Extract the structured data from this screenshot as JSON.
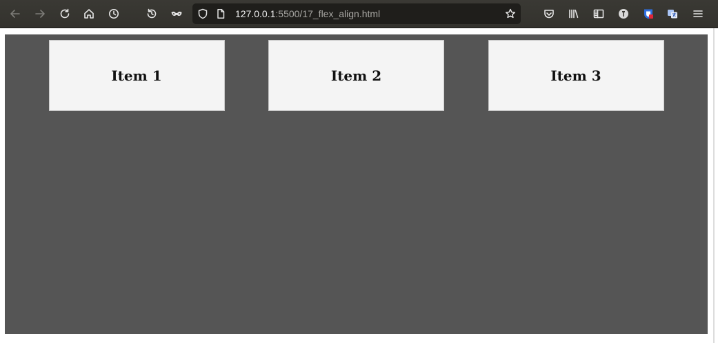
{
  "browser": {
    "url_host": "127.0.0.1",
    "url_path": ":5500/17_flex_align.html",
    "icons": {
      "back": "back-arrow-icon",
      "forward": "forward-arrow-icon",
      "reload": "reload-icon",
      "home": "home-icon",
      "history": "clock-icon",
      "restore": "history-restore-icon",
      "private": "mask-icon",
      "shield": "tracking-shield-icon",
      "page": "page-icon",
      "bookmark": "star-icon",
      "pocket": "pocket-icon",
      "library": "library-icon",
      "sidebar": "sidebar-icon",
      "extension1": "extension-icon",
      "extension2": "extension-icon",
      "extension3": "extension-icon",
      "menu": "hamburger-menu-icon"
    }
  },
  "page": {
    "background": "#555555",
    "items": [
      {
        "label": "Item 1"
      },
      {
        "label": "Item 2"
      },
      {
        "label": "Item 3"
      }
    ]
  }
}
